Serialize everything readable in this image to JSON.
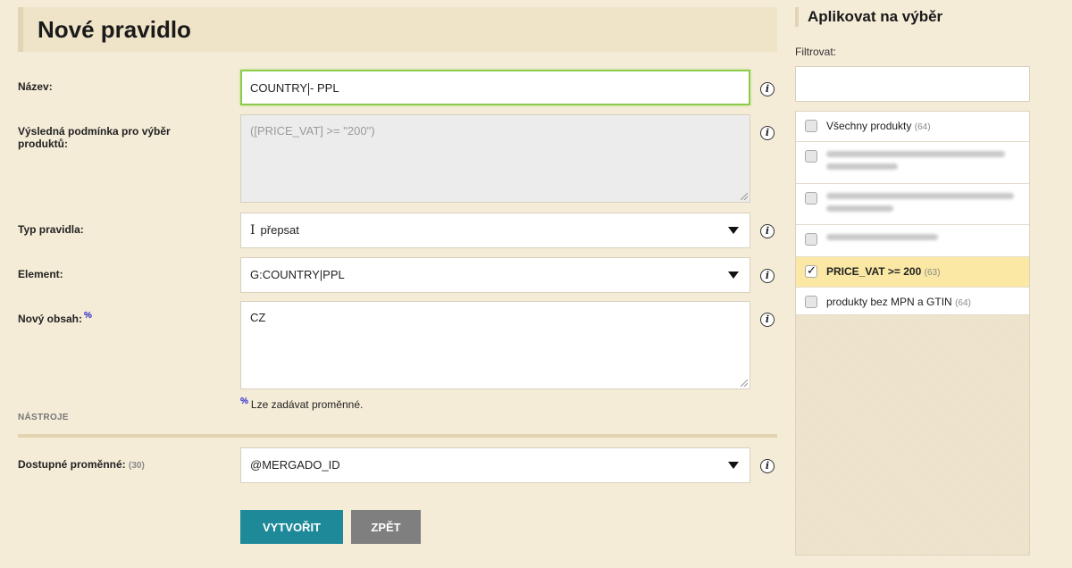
{
  "page": {
    "title": "Nové pravidlo"
  },
  "form": {
    "name": {
      "label": "Název:",
      "value_before": "COUNTRY",
      "value_after": "- PPL"
    },
    "condition": {
      "label": "Výsledná podmínka pro výběr produktů:",
      "value": "([PRICE_VAT] >= \"200\")"
    },
    "rule_type": {
      "label": "Typ pravidla:",
      "value": "přepsat"
    },
    "element": {
      "label": "Element:",
      "value": "G:COUNTRY|PPL"
    },
    "new_content": {
      "label": "Nový obsah:",
      "marker": "%",
      "value": "CZ"
    },
    "hint": {
      "marker": "%",
      "text": "Lze zadávat proměnné."
    },
    "tools_section": "NÁSTROJE",
    "variables": {
      "label": "Dostupné proměnné:",
      "count": "(30)",
      "value": "@MERGADO_ID"
    },
    "info_glyph": "i",
    "buttons": {
      "create": "VYTVOŘIT",
      "back": "ZPĚT"
    }
  },
  "sidebar": {
    "title": "Aplikovat na výběr",
    "filter_label": "Filtrovat:",
    "filter_value": "",
    "items": [
      {
        "label": "Všechny produkty",
        "count": "(64)",
        "checked": false
      },
      {
        "label": "",
        "count": "",
        "checked": false,
        "blurred": true
      },
      {
        "label": "",
        "count": "",
        "checked": false,
        "blurred": true
      },
      {
        "label": "",
        "count": "",
        "checked": false,
        "blurred": true
      },
      {
        "label": "PRICE_VAT >= 200",
        "count": "(63)",
        "checked": true
      },
      {
        "label": "produkty bez MPN a GTIN",
        "count": "(64)",
        "checked": false
      }
    ]
  },
  "colors": {
    "background": "#f5ecd8",
    "primary_button": "#1e8a99",
    "secondary_button": "#7f7f7f",
    "selected_row": "#fae8a4",
    "focus_border": "#8ccc4a"
  }
}
